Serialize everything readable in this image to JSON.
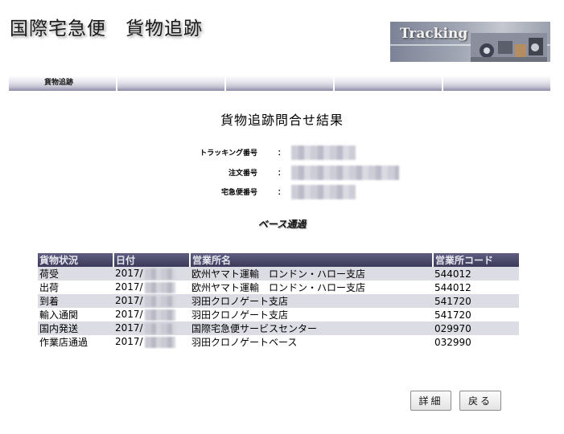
{
  "header": {
    "title": "国際宅急便　貨物追跡",
    "banner_text": "Tracking"
  },
  "nav": {
    "tabs": [
      {
        "label": "貨物追跡"
      },
      {
        "label": ""
      },
      {
        "label": ""
      },
      {
        "label": ""
      },
      {
        "label": ""
      }
    ]
  },
  "result": {
    "heading": "貨物追跡問合せ結果",
    "fields": [
      {
        "label": "トラッキング番号",
        "colon": "：",
        "value": ""
      },
      {
        "label": "注文番号",
        "colon": "：",
        "value": ""
      },
      {
        "label": "宅急便番号",
        "colon": "：",
        "value": ""
      }
    ],
    "section_heading": "ベース通過"
  },
  "table": {
    "headers": [
      "貨物状況",
      "日付",
      "営業所名",
      "営業所コード"
    ],
    "rows": [
      {
        "status": "荷受",
        "date": "2017/",
        "office": "欧州ヤマト運輸　ロンドン・ハロー支店",
        "code": "544012"
      },
      {
        "status": "出荷",
        "date": "2017/",
        "office": "欧州ヤマト運輸　ロンドン・ハロー支店",
        "code": "544012"
      },
      {
        "status": "到着",
        "date": "2017/",
        "office": "羽田クロノゲート支店",
        "code": "541720"
      },
      {
        "status": "輸入通関",
        "date": "2017/",
        "office": "羽田クロノゲート支店",
        "code": "541720"
      },
      {
        "status": "国内発送",
        "date": "2017/",
        "office": "国際宅急便サービスセンター",
        "code": "029970"
      },
      {
        "status": "作業店通過",
        "date": "2017/",
        "office": "羽田クロノゲートベース",
        "code": "032990"
      }
    ]
  },
  "buttons": {
    "detail": "詳細",
    "back": "戻る"
  }
}
